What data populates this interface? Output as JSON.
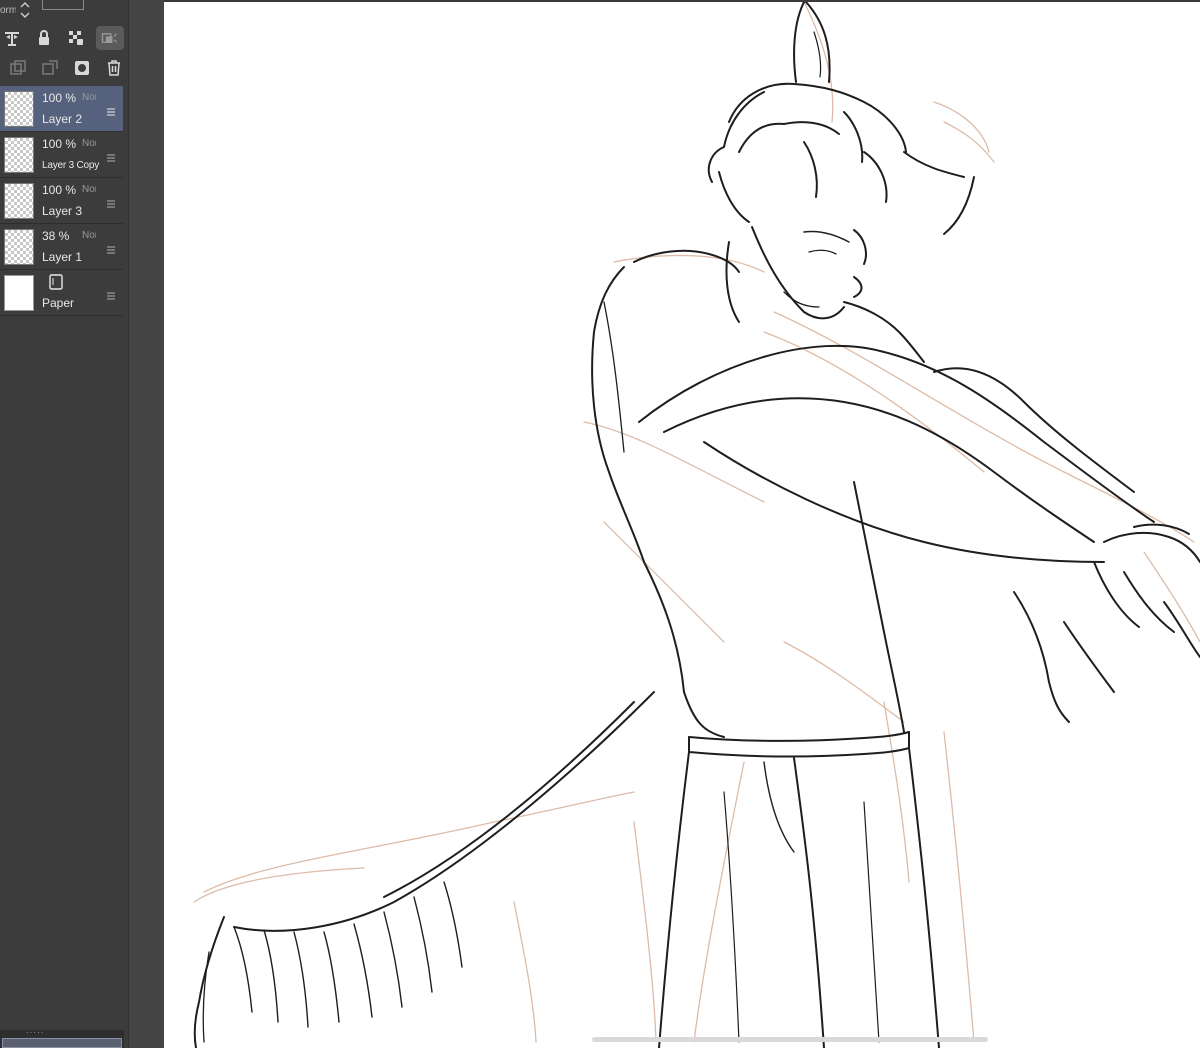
{
  "topbar": {
    "blend_partial": "orm"
  },
  "tools": {
    "row1": [
      "reference-layer-icon",
      "lock-icon",
      "lock-transparency-icon",
      "clip-mask-icon"
    ],
    "row2": [
      "new-raster-layer-icon",
      "new-vector-layer-icon",
      "layer-mask-icon",
      "delete-icon"
    ]
  },
  "layers": [
    {
      "opacity": "100 %",
      "blend": "Normal",
      "name": "Layer 2",
      "selected": true
    },
    {
      "opacity": "100 %",
      "blend": "Normal",
      "name": "Layer 3 Copy",
      "selected": false
    },
    {
      "opacity": "100 %",
      "blend": "Normal",
      "name": "Layer 3",
      "selected": false
    },
    {
      "opacity": "38 %",
      "blend": "Normal",
      "name": "Layer 1",
      "selected": false
    }
  ],
  "paper": {
    "name": "Paper"
  },
  "colors": {
    "panel": "#3c3c3c",
    "selected_layer": "#56627d",
    "canvas": "#ffffff",
    "sketch_line": "#1e1e1e",
    "rough_line": "#d9b8a6"
  }
}
